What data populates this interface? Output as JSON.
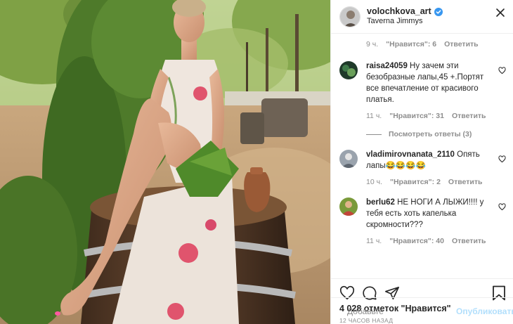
{
  "header": {
    "username": "volochkova_art",
    "location": "Taverna Jimmys"
  },
  "comments": [
    {
      "username": "",
      "text": "",
      "time": "9 ч.",
      "likes": "\"Нравится\": 6",
      "reply": "Ответить"
    },
    {
      "username": "raisa24059",
      "text": " Ну зачем эти безобразные лапы,45 +.Портят все впечатление от красивого платья.",
      "time": "11 ч.",
      "likes": "\"Нравится\": 31",
      "reply": "Ответить",
      "view_replies": "Посмотреть ответы (3)"
    },
    {
      "username": "vladimirovnanata_2110",
      "text": " Опять лапы😂😂😂😂",
      "time": "10 ч.",
      "likes": "\"Нравится\": 2",
      "reply": "Ответить"
    },
    {
      "username": "berlu62",
      "text": " НЕ НОГИ А ЛЫЖИ!!!! у тебя есть хоть капелька скромности???",
      "time": "11 ч.",
      "likes": "\"Нравится\": 40",
      "reply": "Ответить"
    }
  ],
  "post": {
    "likes_count": "4 028 отметок \"Нравится\"",
    "posted_ago": "12 часов назад"
  },
  "add_comment": {
    "placeholder": "Добавьте",
    "publish_label": "Опубликовать"
  },
  "colors": {
    "verified": "#3897f0",
    "publish_disabled": "#b2dffc",
    "secondary_text": "#8e8e8e"
  }
}
